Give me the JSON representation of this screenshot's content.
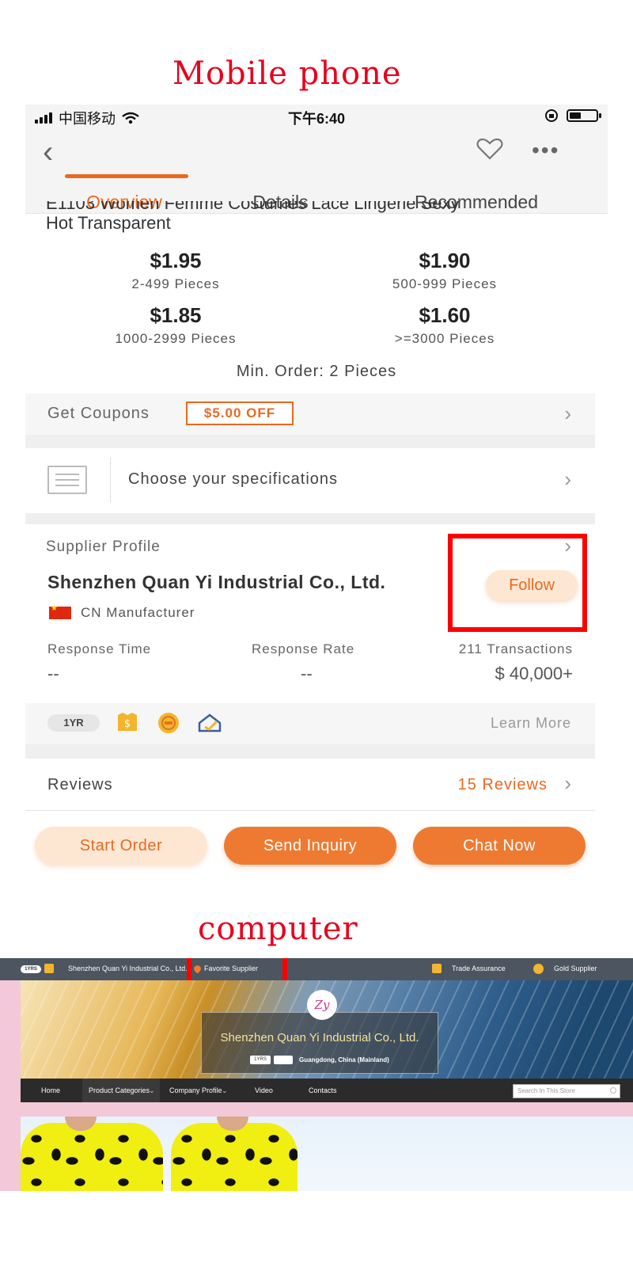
{
  "annotations": {
    "mobile_title": "Mobile phone",
    "computer_title": "computer"
  },
  "colors": {
    "accent": "#e96a1f",
    "highlight_box": "#ff0000"
  },
  "mobile": {
    "statusbar": {
      "carrier": "中国移动",
      "time": "下午6:40",
      "icons": [
        "signal-icon",
        "wifi-icon",
        "orientation-lock-icon",
        "battery-icon"
      ]
    },
    "navbar": {
      "icons": [
        "back-icon",
        "heart-icon",
        "more-icon"
      ],
      "tabs": [
        "Overview",
        "Details",
        "Recommended"
      ],
      "active_tab": "Overview"
    },
    "product_title": {
      "line1": "E1103 Women Femme Costumes Lace Lingerie Sexy",
      "line2": "Hot Transparent"
    },
    "prices": [
      {
        "price": "$1.95",
        "qty": "2-499 Pieces"
      },
      {
        "price": "$1.90",
        "qty": "500-999 Pieces"
      },
      {
        "price": "$1.85",
        "qty": "1000-2999 Pieces"
      },
      {
        "price": "$1.60",
        "qty": ">=3000 Pieces"
      }
    ],
    "min_order": "Min. Order: 2 Pieces",
    "coupons": {
      "label": "Get Coupons",
      "badge": "$5.00 OFF"
    },
    "specifications": {
      "label": "Choose your specifications"
    },
    "supplier": {
      "heading": "Supplier Profile",
      "company": "Shenzhen Quan Yi Industrial Co., Ltd.",
      "type": "CN Manufacturer",
      "follow": "Follow",
      "stats": [
        {
          "label": "Response Time",
          "value": "--"
        },
        {
          "label": "Response Rate",
          "value": "--"
        },
        {
          "label": "211 Transactions",
          "value": "$ 40,000+"
        }
      ]
    },
    "badges": {
      "years": "1YR",
      "learn_more": "Learn More",
      "icons": [
        "trade-assurance-icon",
        "gold-supplier-icon",
        "verified-icon"
      ]
    },
    "reviews": {
      "label": "Reviews",
      "count": "15 Reviews"
    },
    "actions": {
      "start_order": "Start Order",
      "send_inquiry": "Send Inquiry",
      "chat_now": "Chat Now"
    }
  },
  "desktop": {
    "topbar": {
      "years": "1YRS",
      "company": "Shenzhen Quan Yi Industrial Co., Ltd.",
      "favorite": "Favorite Supplier",
      "trade_assurance": "Trade Assurance",
      "gold_supplier": "Gold Supplier"
    },
    "banner": {
      "logo": "Zy",
      "company": "Shenzhen Quan Yi Industrial Co., Ltd.",
      "years": "1YRS",
      "location": "Guangdong, China (Mainland)"
    },
    "menu": {
      "home": "Home",
      "product_categories": "Product Categories",
      "company_profile": "Company Profile",
      "video": "Video",
      "contacts": "Contacts",
      "search_placeholder": "Search In This Store"
    }
  }
}
